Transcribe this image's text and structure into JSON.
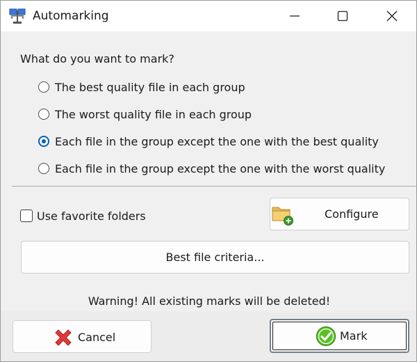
{
  "window": {
    "title": "Automarking",
    "icon": "app-scales-icon"
  },
  "question": "What do you want to mark?",
  "options": [
    {
      "label": "The best quality file in each group",
      "selected": false
    },
    {
      "label": "The worst quality file in each group",
      "selected": false
    },
    {
      "label": "Each file in the group except the one with the best quality",
      "selected": true
    },
    {
      "label": "Each file in the group except the one with the worst quality",
      "selected": false
    }
  ],
  "favorites": {
    "label": "Use favorite folders",
    "checked": false,
    "configure_label": "Configure",
    "configure_icon": "folder-add-icon"
  },
  "criteria_label": "Best file criteria...",
  "warning": "Warning! All existing marks will be deleted!",
  "buttons": {
    "cancel_label": "Cancel",
    "cancel_icon": "red-x-icon",
    "mark_label": "Mark",
    "mark_icon": "green-check-icon"
  },
  "colors": {
    "accent": "#005fb8",
    "cancel_red": "#e03a3a",
    "mark_green": "#4caf1a"
  }
}
